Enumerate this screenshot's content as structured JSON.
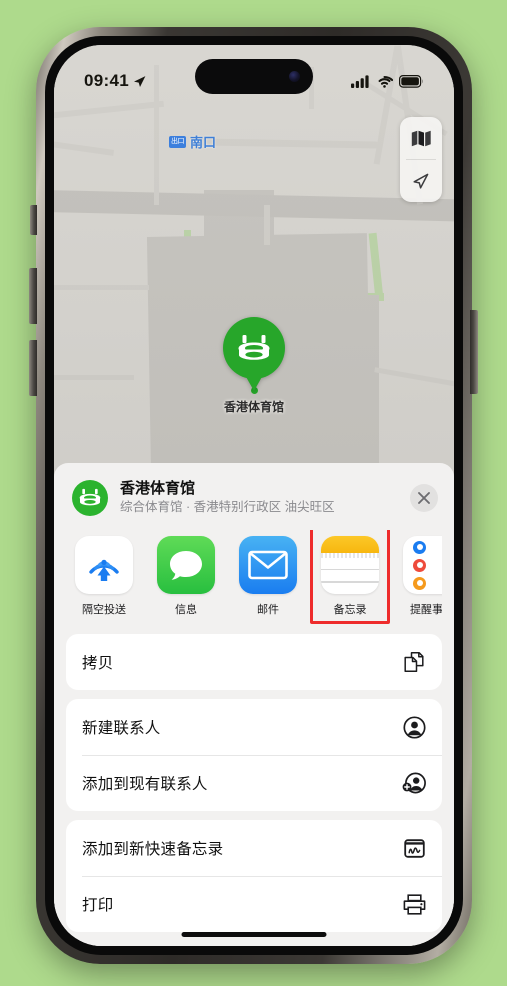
{
  "background_color": "#aeda8c",
  "status_bar": {
    "time": "09:41",
    "location_arrow": "location-arrow-icon",
    "cellular": "signal-bars-icon",
    "wifi": "wifi-icon",
    "battery": "battery-icon"
  },
  "map": {
    "transit_label": {
      "badge": "出口",
      "name": "南口"
    },
    "controls": [
      {
        "name": "map-layers-icon"
      },
      {
        "name": "location-arrow-icon"
      }
    ],
    "pin": {
      "label": "香港体育馆",
      "icon": "stadium-icon",
      "color": "#27a62a"
    }
  },
  "share_sheet": {
    "place": {
      "icon": "stadium-icon",
      "icon_color": "#2bb32e",
      "title": "香港体育馆",
      "subtitle": "综合体育馆 · 香港特别行政区 油尖旺区"
    },
    "close_label": "✕",
    "apps": [
      {
        "label": "隔空投送",
        "icon": "airdrop-icon",
        "highlighted": false
      },
      {
        "label": "信息",
        "icon": "messages-icon",
        "highlighted": false
      },
      {
        "label": "邮件",
        "icon": "mail-icon",
        "highlighted": false
      },
      {
        "label": "备忘录",
        "icon": "notes-icon",
        "highlighted": true
      },
      {
        "label": "提醒事项",
        "icon": "reminders-icon",
        "highlighted": false
      }
    ],
    "highlight_color": "#ee2c2c",
    "action_groups": [
      {
        "rows": [
          {
            "label": "拷贝",
            "icon": "copy-icon"
          }
        ]
      },
      {
        "rows": [
          {
            "label": "新建联系人",
            "icon": "new-contact-icon"
          },
          {
            "label": "添加到现有联系人",
            "icon": "add-to-contact-icon"
          }
        ]
      },
      {
        "rows": [
          {
            "label": "添加到新快速备忘录",
            "icon": "quick-note-icon"
          },
          {
            "label": "打印",
            "icon": "printer-icon"
          }
        ]
      }
    ]
  }
}
